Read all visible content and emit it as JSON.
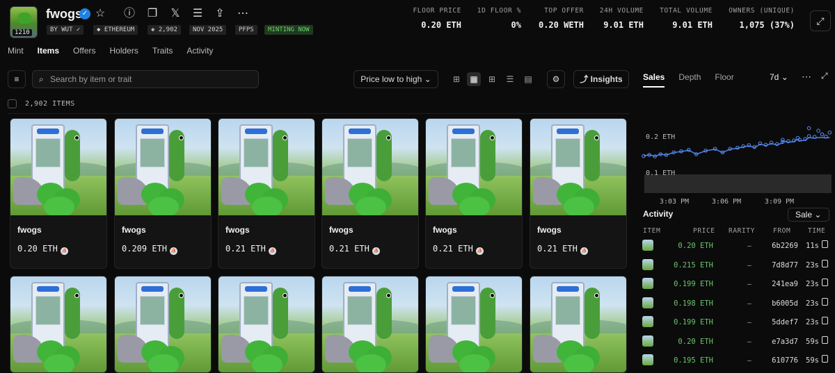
{
  "header": {
    "collection_name": "fwogs",
    "thumb_badge": "1210",
    "pills": [
      "BY WUT",
      "ETHEREUM",
      "2,902",
      "NOV 2025",
      "PFPS",
      "MINTING NOW"
    ],
    "stats": [
      {
        "label": "FLOOR PRICE",
        "value": "0.20 ETH"
      },
      {
        "label": "1D FLOOR %",
        "value": "0%"
      },
      {
        "label": "TOP OFFER",
        "value": "0.20 WETH"
      },
      {
        "label": "24H VOLUME",
        "value": "9.01 ETH"
      },
      {
        "label": "TOTAL VOLUME",
        "value": "9.01 ETH"
      },
      {
        "label": "OWNERS (UNIQUE)",
        "value": "1,075 (37%)"
      }
    ]
  },
  "tabs": [
    "Mint",
    "Items",
    "Offers",
    "Holders",
    "Traits",
    "Activity"
  ],
  "toolbar": {
    "search_placeholder": "Search by item or trait",
    "sort_label": "Price low to high",
    "insights_label": "Insights"
  },
  "items_count": "2,902 ITEMS",
  "cards": [
    {
      "name": "fwogs",
      "price": "0.20 ETH"
    },
    {
      "name": "fwogs",
      "price": "0.209 ETH"
    },
    {
      "name": "fwogs",
      "price": "0.21 ETH"
    },
    {
      "name": "fwogs",
      "price": "0.21 ETH"
    },
    {
      "name": "fwogs",
      "price": "0.21 ETH"
    },
    {
      "name": "fwogs",
      "price": "0.21 ETH"
    },
    {
      "name": "",
      "price": ""
    },
    {
      "name": "",
      "price": ""
    },
    {
      "name": "",
      "price": ""
    },
    {
      "name": "",
      "price": ""
    },
    {
      "name": "",
      "price": ""
    },
    {
      "name": "",
      "price": ""
    }
  ],
  "right_panel": {
    "tabs": [
      "Sales",
      "Depth",
      "Floor"
    ],
    "range": "7d",
    "activity_title": "Activity",
    "activity_filter": "Sale",
    "columns": [
      "ITEM",
      "PRICE",
      "RARITY",
      "FROM",
      "TIME"
    ],
    "rows": [
      {
        "price": "0.20 ETH",
        "rarity": "–",
        "from": "6b2269",
        "time": "11s"
      },
      {
        "price": "0.215 ETH",
        "rarity": "–",
        "from": "7d8d77",
        "time": "23s"
      },
      {
        "price": "0.199 ETH",
        "rarity": "–",
        "from": "241ea9",
        "time": "23s"
      },
      {
        "price": "0.198 ETH",
        "rarity": "–",
        "from": "b6005d",
        "time": "23s"
      },
      {
        "price": "0.199 ETH",
        "rarity": "–",
        "from": "5ddef7",
        "time": "23s"
      },
      {
        "price": "0.20 ETH",
        "rarity": "–",
        "from": "e7a3d7",
        "time": "59s"
      },
      {
        "price": "0.195 ETH",
        "rarity": "–",
        "from": "610776",
        "time": "59s"
      }
    ]
  },
  "chart_data": {
    "type": "scatter",
    "x_ticks": [
      "3:03 PM",
      "3:06 PM",
      "3:09 PM"
    ],
    "y_ticks": [
      "0.2 ETH",
      "0.1 ETH"
    ],
    "ylim": [
      0.1,
      0.25
    ],
    "points": [
      {
        "x": 0.0,
        "y": 0.145
      },
      {
        "x": 0.03,
        "y": 0.148
      },
      {
        "x": 0.06,
        "y": 0.144
      },
      {
        "x": 0.09,
        "y": 0.15
      },
      {
        "x": 0.12,
        "y": 0.148
      },
      {
        "x": 0.16,
        "y": 0.155
      },
      {
        "x": 0.2,
        "y": 0.158
      },
      {
        "x": 0.24,
        "y": 0.162
      },
      {
        "x": 0.28,
        "y": 0.15
      },
      {
        "x": 0.33,
        "y": 0.16
      },
      {
        "x": 0.38,
        "y": 0.165
      },
      {
        "x": 0.42,
        "y": 0.155
      },
      {
        "x": 0.46,
        "y": 0.165
      },
      {
        "x": 0.5,
        "y": 0.168
      },
      {
        "x": 0.53,
        "y": 0.172
      },
      {
        "x": 0.56,
        "y": 0.175
      },
      {
        "x": 0.59,
        "y": 0.17
      },
      {
        "x": 0.62,
        "y": 0.18
      },
      {
        "x": 0.65,
        "y": 0.176
      },
      {
        "x": 0.68,
        "y": 0.182
      },
      {
        "x": 0.71,
        "y": 0.178
      },
      {
        "x": 0.74,
        "y": 0.184
      },
      {
        "x": 0.77,
        "y": 0.186
      },
      {
        "x": 0.8,
        "y": 0.188
      },
      {
        "x": 0.83,
        "y": 0.19
      },
      {
        "x": 0.86,
        "y": 0.192
      },
      {
        "x": 0.88,
        "y": 0.2
      },
      {
        "x": 0.91,
        "y": 0.198
      },
      {
        "x": 0.93,
        "y": 0.215
      },
      {
        "x": 0.95,
        "y": 0.205
      },
      {
        "x": 0.97,
        "y": 0.199
      },
      {
        "x": 0.99,
        "y": 0.21
      },
      {
        "x": 0.82,
        "y": 0.195
      },
      {
        "x": 0.74,
        "y": 0.19
      },
      {
        "x": 0.88,
        "y": 0.222
      }
    ]
  },
  "colors": {
    "accent": "#2081e2",
    "positive": "#6ac56a",
    "mint_green": "#6fd26a",
    "line": "#4a7fe0"
  }
}
